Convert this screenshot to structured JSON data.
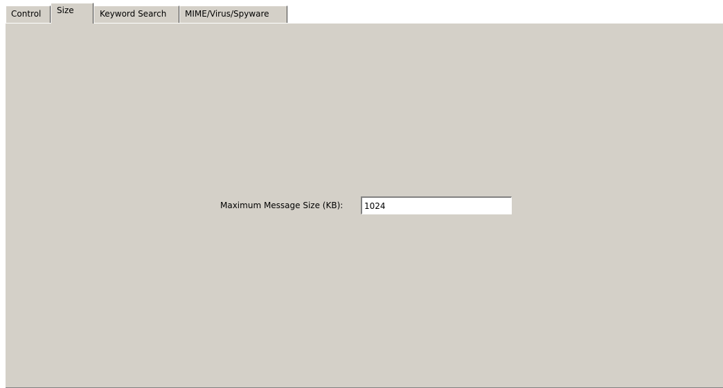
{
  "tabs": {
    "control": "Control",
    "size": "Size",
    "keyword_search": "Keyword Search",
    "mime_virus_spyware": "MIME/Virus/Spyware",
    "selected": "Size"
  },
  "size_panel": {
    "max_message_size_label": "Maximum Message Size (KB):",
    "max_message_size_value": "1024"
  },
  "colors": {
    "panel_background": "#d4d0c8",
    "window_background": "#ffffff"
  }
}
